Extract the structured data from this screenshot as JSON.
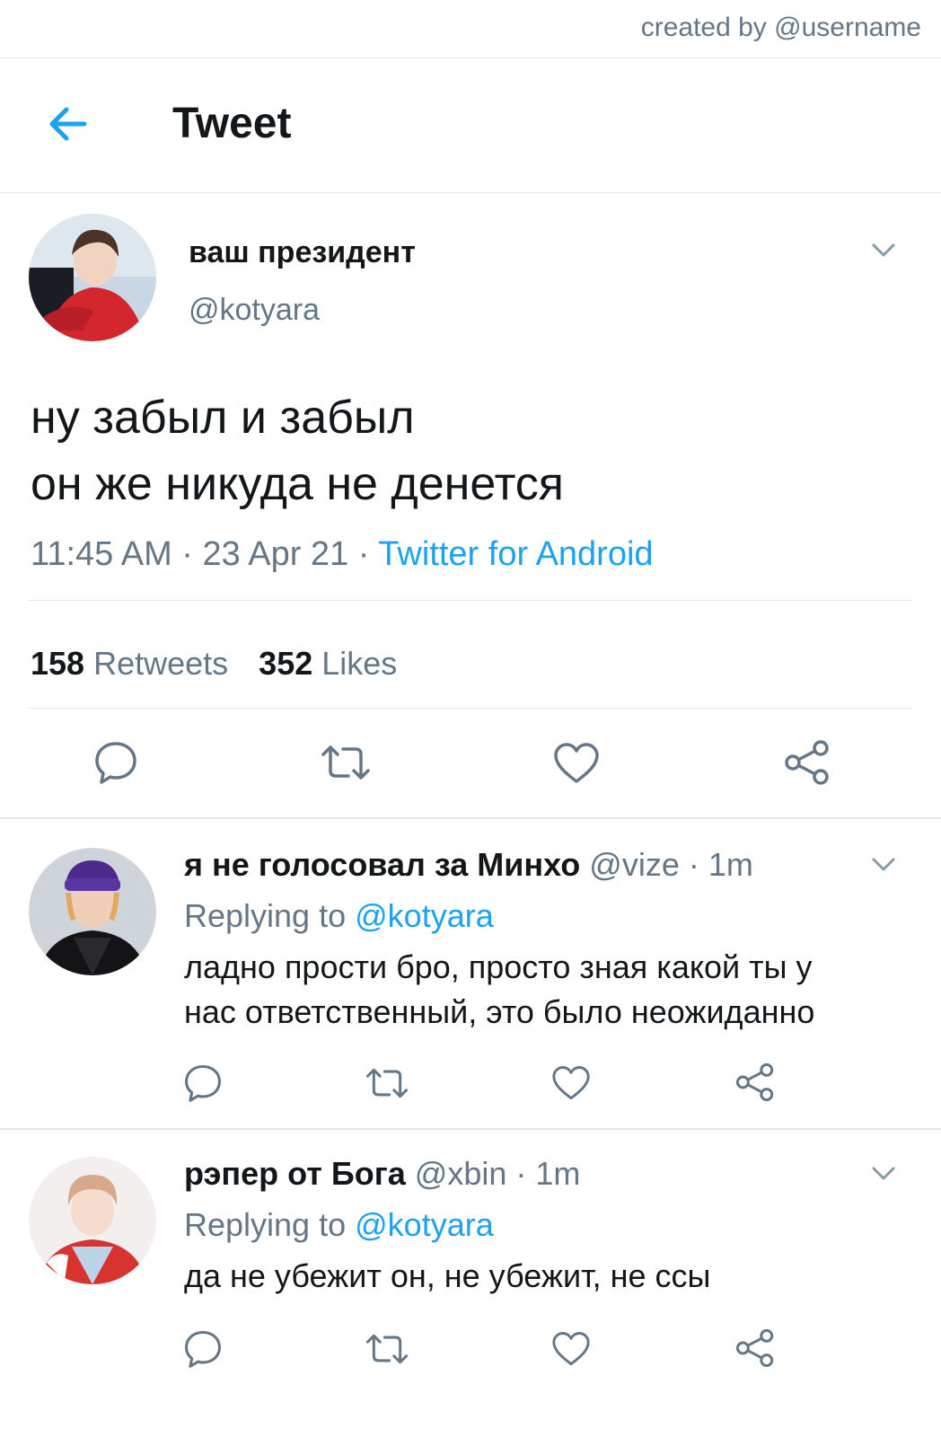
{
  "credit": "created by @username",
  "header": {
    "title": "Tweet"
  },
  "tweet": {
    "name": "ваш президент",
    "handle": "@kotyara",
    "text_lines": [
      "ну забыл и забыл",
      "он же никуда не денется"
    ],
    "time": "11:45 AM",
    "date": "23 Apr 21",
    "source": "Twitter for Android",
    "retweets_count": "158",
    "retweets_label": "Retweets",
    "likes_count": "352",
    "likes_label": "Likes"
  },
  "replies": [
    {
      "name": "я не голосовал за Минхо",
      "handle": "@vize",
      "time": "1m",
      "replying_prefix": "Replying to",
      "replying_to": "@kotyara",
      "text_lines": [
        "ладно прости бро, просто зная какой ты у",
        "нас ответственный, это было неожиданно"
      ]
    },
    {
      "name": "рэпер от Бога",
      "handle": "@xbin",
      "time": "1m",
      "replying_prefix": "Replying to",
      "replying_to": "@kotyara",
      "text_lines": [
        "да не убежит он, не убежит, не ссы"
      ]
    }
  ],
  "icons": {
    "back": "arrow-left-icon",
    "caret": "chevron-down-icon",
    "reply": "reply-icon",
    "retweet": "retweet-icon",
    "like": "heart-icon",
    "share": "share-icon"
  },
  "colors": {
    "accent": "#1da1f2",
    "secondary_text": "#657786",
    "primary_text": "#14171a",
    "divider": "#e1e8ed"
  }
}
